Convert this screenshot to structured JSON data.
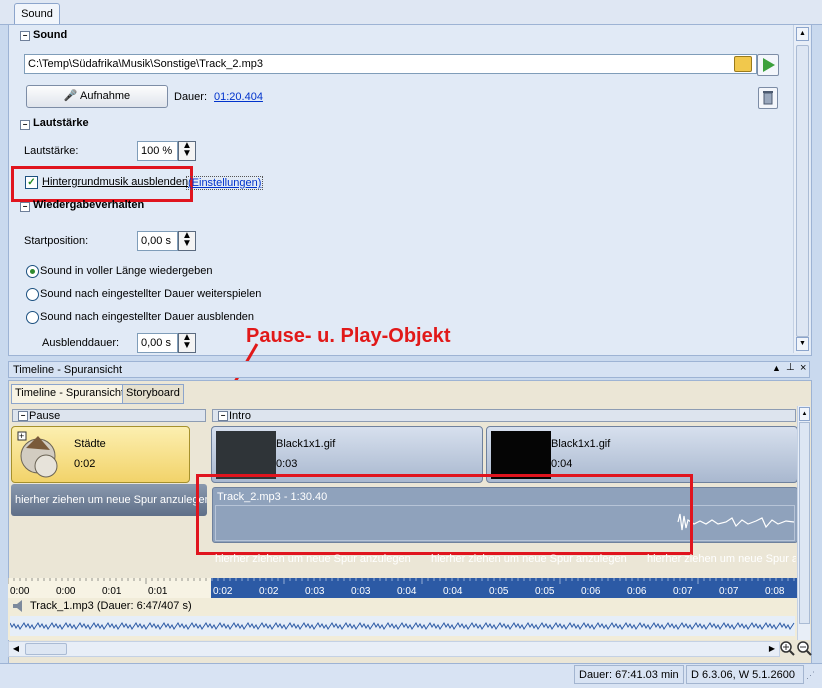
{
  "sound_tab": "Sound",
  "sections": {
    "sound": "Sound",
    "volume": "Lautstärke",
    "playback": "Wiedergabeverhalten"
  },
  "sound": {
    "file_path": "C:\\Temp\\Südafrika\\Musik\\Sonstige\\Track_2.mp3",
    "record_label": "Aufnahme",
    "duration_label": "Dauer:",
    "duration_value": "01:20.404"
  },
  "volume": {
    "label": "Lautstärke:",
    "value": "100 %",
    "bg_music_label": "Hintergrundmusik ausblenden",
    "bg_music_checked": true,
    "settings_link": "(Einstellungen)"
  },
  "playback": {
    "start_label": "Startposition:",
    "start_value": "0,00 s",
    "options": [
      "Sound in voller Länge wiedergeben",
      "Sound nach eingestellter Dauer weiterspielen",
      "Sound nach eingestellter Dauer ausblenden"
    ],
    "selected_index": 0,
    "fade_label": "Ausblenddauer:",
    "fade_value": "0,00 s"
  },
  "annotation": "Pause- u. Play-Objekt",
  "timeline": {
    "title": "Timeline - Spuransicht",
    "tabs": [
      "Timeline - Spuransicht",
      "Storyboard"
    ],
    "active_tab": 0,
    "groups": [
      "Pause",
      "Intro"
    ],
    "clips": [
      {
        "name": "Städte",
        "time": "0:02"
      },
      {
        "name": "Black1x1.gif",
        "time": "0:03"
      },
      {
        "name": "Black1x1.gif",
        "time": "0:04"
      }
    ],
    "audio_clip": "Track_2.mp3 - 1:30.40",
    "dropzone": "hierher ziehen um neue Spur anzulegen",
    "ruler_left": [
      "0:00",
      "0:00",
      "0:01",
      "0:01"
    ],
    "ruler_right": [
      "0:02",
      "0:02",
      "0:03",
      "0:03",
      "0:04",
      "0:04",
      "0:05",
      "0:05",
      "0:06",
      "0:06",
      "0:07",
      "0:07",
      "0:08"
    ],
    "bg_track": "Track_1.mp3 (Dauer: 6:47/407 s)"
  },
  "status": {
    "duration": "Dauer: 67:41.03 min",
    "version": "D 6.3.06, W 5.1.2600"
  },
  "colors": {
    "annotation_red": "#e0141e",
    "pause_clip_yellow": "#f7e28a",
    "timeline_blue": "#2c5aa5"
  }
}
